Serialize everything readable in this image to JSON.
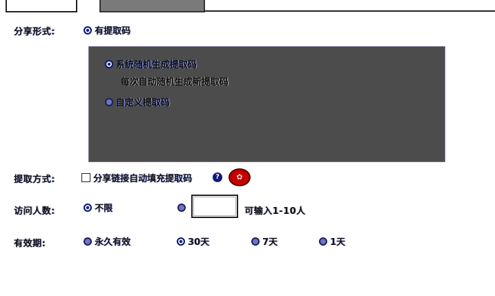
{
  "tabs": [
    {
      "label": ""
    },
    {
      "label": ""
    }
  ],
  "share_form": {
    "label": "分享形式:",
    "option": "有提取码"
  },
  "code_panel": {
    "option_random": "系统随机生成提取码",
    "option_random_hint": "每次自动随机生成新提取码",
    "option_custom": "自定义提取码"
  },
  "extract_method": {
    "label": "提取方式:",
    "checkbox_label": "分享链接自动填充提取码",
    "help_icon": "help-icon",
    "badge_icon": "red-stamp-icon"
  },
  "visitors": {
    "label": "访问人数:",
    "option_unlimited": "不限",
    "input_value": "",
    "hint": "可输入1-10人"
  },
  "validity": {
    "label": "有效期:",
    "options": [
      "永久有效",
      "30天",
      "7天",
      "1天"
    ]
  }
}
